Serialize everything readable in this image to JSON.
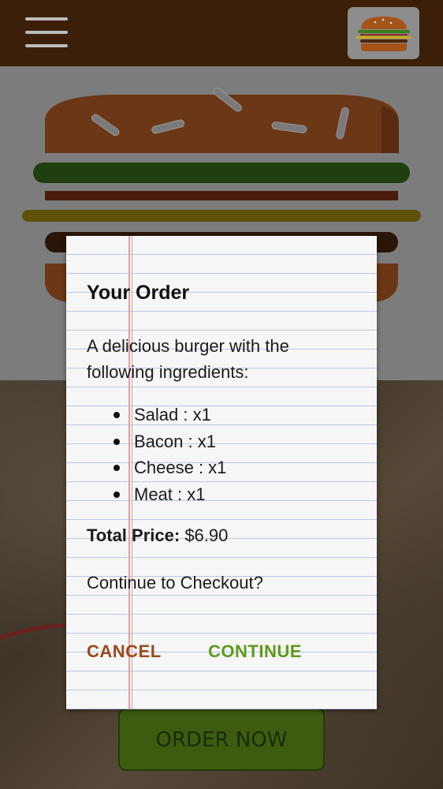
{
  "toolbar": {
    "menu_icon": "hamburger-menu-icon",
    "logo_icon": "burger-logo-icon"
  },
  "background": {
    "order_button_label": "ORDER NOW"
  },
  "modal": {
    "title": "Your Order",
    "description": "A delicious burger with the following ingredients:",
    "ingredients": [
      "Salad : x1",
      "Bacon : x1",
      "Cheese : x1",
      "Meat : x1"
    ],
    "price_label": "Total Price:",
    "price_value": "$6.90",
    "question": "Continue to Checkout?",
    "cancel_label": "CANCEL",
    "continue_label": "CONTINUE"
  },
  "colors": {
    "toolbar": "#3b1f08",
    "cancel": "#9c4a1c",
    "continue": "#5f9a1c",
    "order_button": "#3d5c10"
  }
}
